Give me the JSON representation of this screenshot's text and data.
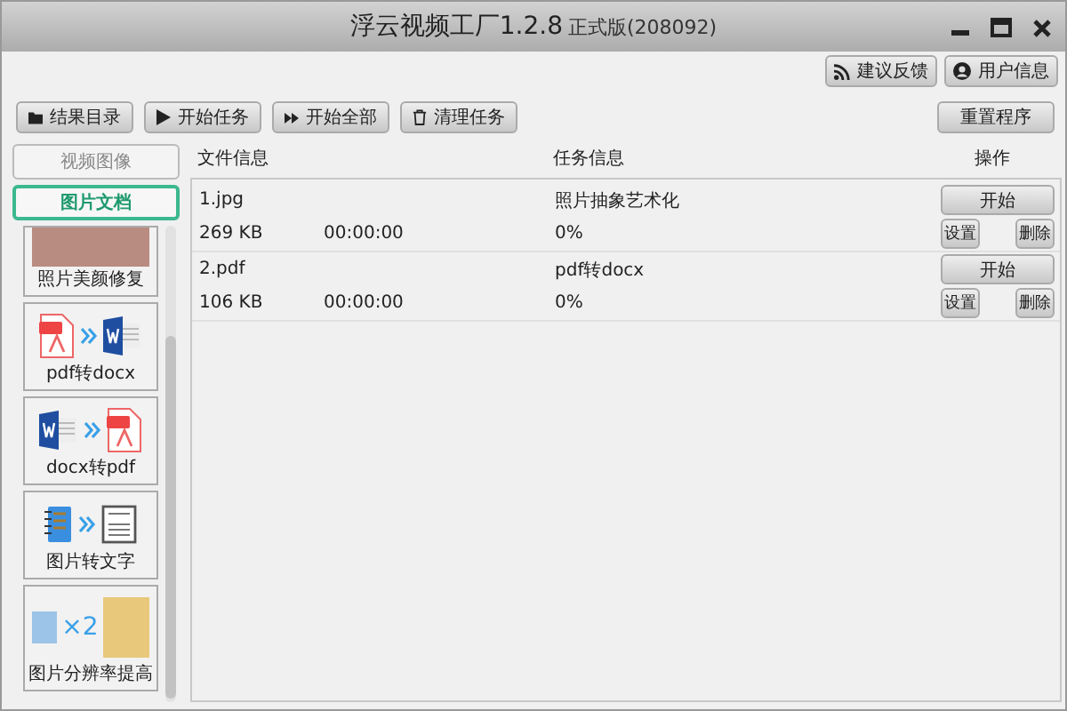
{
  "window": {
    "title": "浮云视频工厂1.2.8",
    "edition": "正式版(208092)"
  },
  "top_buttons": [
    {
      "label": "建议反馈",
      "kind": "rss"
    },
    {
      "label": "用户信息",
      "kind": "user"
    }
  ],
  "toolbar": [
    {
      "label": "结果目录",
      "kind": "folder"
    },
    {
      "label": "开始任务",
      "kind": "play"
    },
    {
      "label": "开始全部",
      "kind": "fast-forward"
    },
    {
      "label": "清理任务",
      "kind": "trash"
    }
  ],
  "reset_button": "重置程序",
  "sidebar": {
    "tabs": [
      {
        "label": "视频图像",
        "selected": false
      },
      {
        "label": "图片文档",
        "selected": true
      }
    ],
    "cards": [
      {
        "label": "照片美颜修复",
        "kind": "photo"
      },
      {
        "label": "pdf转docx",
        "kind": "pdf-to-docx"
      },
      {
        "label": "docx转pdf",
        "kind": "docx-to-pdf"
      },
      {
        "label": "图片转文字",
        "kind": "image-to-text"
      },
      {
        "label": "图片分辨率提高",
        "kind": "upscale",
        "factor": "×2"
      }
    ]
  },
  "table": {
    "columns": [
      "文件信息",
      "任务信息",
      "操作"
    ],
    "rows": [
      {
        "name": "1.jpg",
        "size": "269 KB",
        "time": "00:00:00",
        "task": "照片抽象艺术化",
        "progress": "0%",
        "start": "开始",
        "settings": "设置",
        "delete": "删除"
      },
      {
        "name": "2.pdf",
        "size": "106 KB",
        "time": "00:00:00",
        "task": "pdf转docx",
        "progress": "0%",
        "start": "开始",
        "settings": "设置",
        "delete": "删除"
      }
    ]
  }
}
